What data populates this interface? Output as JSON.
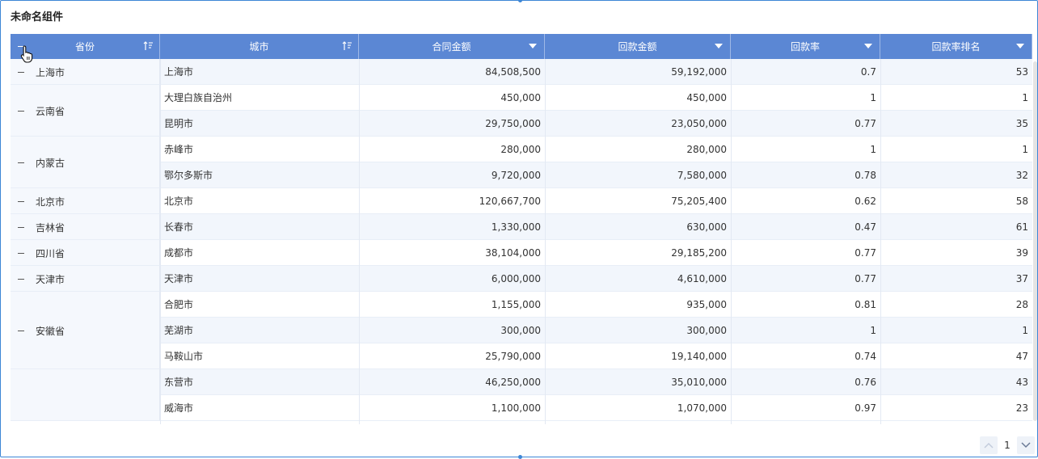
{
  "component": {
    "title": "未命名组件"
  },
  "table": {
    "columns": [
      {
        "key": "province",
        "label": "省份",
        "control": "sort-filter"
      },
      {
        "key": "city",
        "label": "城市",
        "control": "sort-filter"
      },
      {
        "key": "contract",
        "label": "合同金额",
        "control": "dropdown"
      },
      {
        "key": "payment",
        "label": "回款金额",
        "control": "dropdown"
      },
      {
        "key": "rate",
        "label": "回款率",
        "control": "dropdown"
      },
      {
        "key": "rank",
        "label": "回款率排名",
        "control": "dropdown"
      }
    ],
    "groups": [
      {
        "province": "上海市",
        "rows": [
          {
            "city": "上海市",
            "contract": "84,508,500",
            "payment": "59,192,000",
            "rate": "0.7",
            "rank": "53"
          }
        ]
      },
      {
        "province": "云南省",
        "rows": [
          {
            "city": "大理白族自治州",
            "contract": "450,000",
            "payment": "450,000",
            "rate": "1",
            "rank": "1"
          },
          {
            "city": "昆明市",
            "contract": "29,750,000",
            "payment": "23,050,000",
            "rate": "0.77",
            "rank": "35"
          }
        ]
      },
      {
        "province": "内蒙古",
        "rows": [
          {
            "city": "赤峰市",
            "contract": "280,000",
            "payment": "280,000",
            "rate": "1",
            "rank": "1"
          },
          {
            "city": "鄂尔多斯市",
            "contract": "9,720,000",
            "payment": "7,580,000",
            "rate": "0.78",
            "rank": "32"
          }
        ]
      },
      {
        "province": "北京市",
        "rows": [
          {
            "city": "北京市",
            "contract": "120,667,700",
            "payment": "75,205,400",
            "rate": "0.62",
            "rank": "58"
          }
        ]
      },
      {
        "province": "吉林省",
        "rows": [
          {
            "city": "长春市",
            "contract": "1,330,000",
            "payment": "630,000",
            "rate": "0.47",
            "rank": "61"
          }
        ]
      },
      {
        "province": "四川省",
        "rows": [
          {
            "city": "成都市",
            "contract": "38,104,000",
            "payment": "29,185,200",
            "rate": "0.77",
            "rank": "39"
          }
        ]
      },
      {
        "province": "天津市",
        "rows": [
          {
            "city": "天津市",
            "contract": "6,000,000",
            "payment": "4,610,000",
            "rate": "0.77",
            "rank": "37"
          }
        ]
      },
      {
        "province": "安徽省",
        "rows": [
          {
            "city": "合肥市",
            "contract": "1,155,000",
            "payment": "935,000",
            "rate": "0.81",
            "rank": "28"
          },
          {
            "city": "芜湖市",
            "contract": "300,000",
            "payment": "300,000",
            "rate": "1",
            "rank": "1"
          },
          {
            "city": "马鞍山市",
            "contract": "25,790,000",
            "payment": "19,140,000",
            "rate": "0.74",
            "rank": "47"
          }
        ]
      },
      {
        "province": "",
        "rows": [
          {
            "city": "东营市",
            "contract": "46,250,000",
            "payment": "35,010,000",
            "rate": "0.76",
            "rank": "43"
          },
          {
            "city": "威海市",
            "contract": "1,100,000",
            "payment": "1,070,000",
            "rate": "0.97",
            "rank": "23"
          }
        ]
      }
    ]
  },
  "pagination": {
    "current_page": "1"
  },
  "colors": {
    "header_bg": "#5b87d4",
    "row_alt": "#f2f6fc",
    "frame_border": "#3d86d6"
  }
}
